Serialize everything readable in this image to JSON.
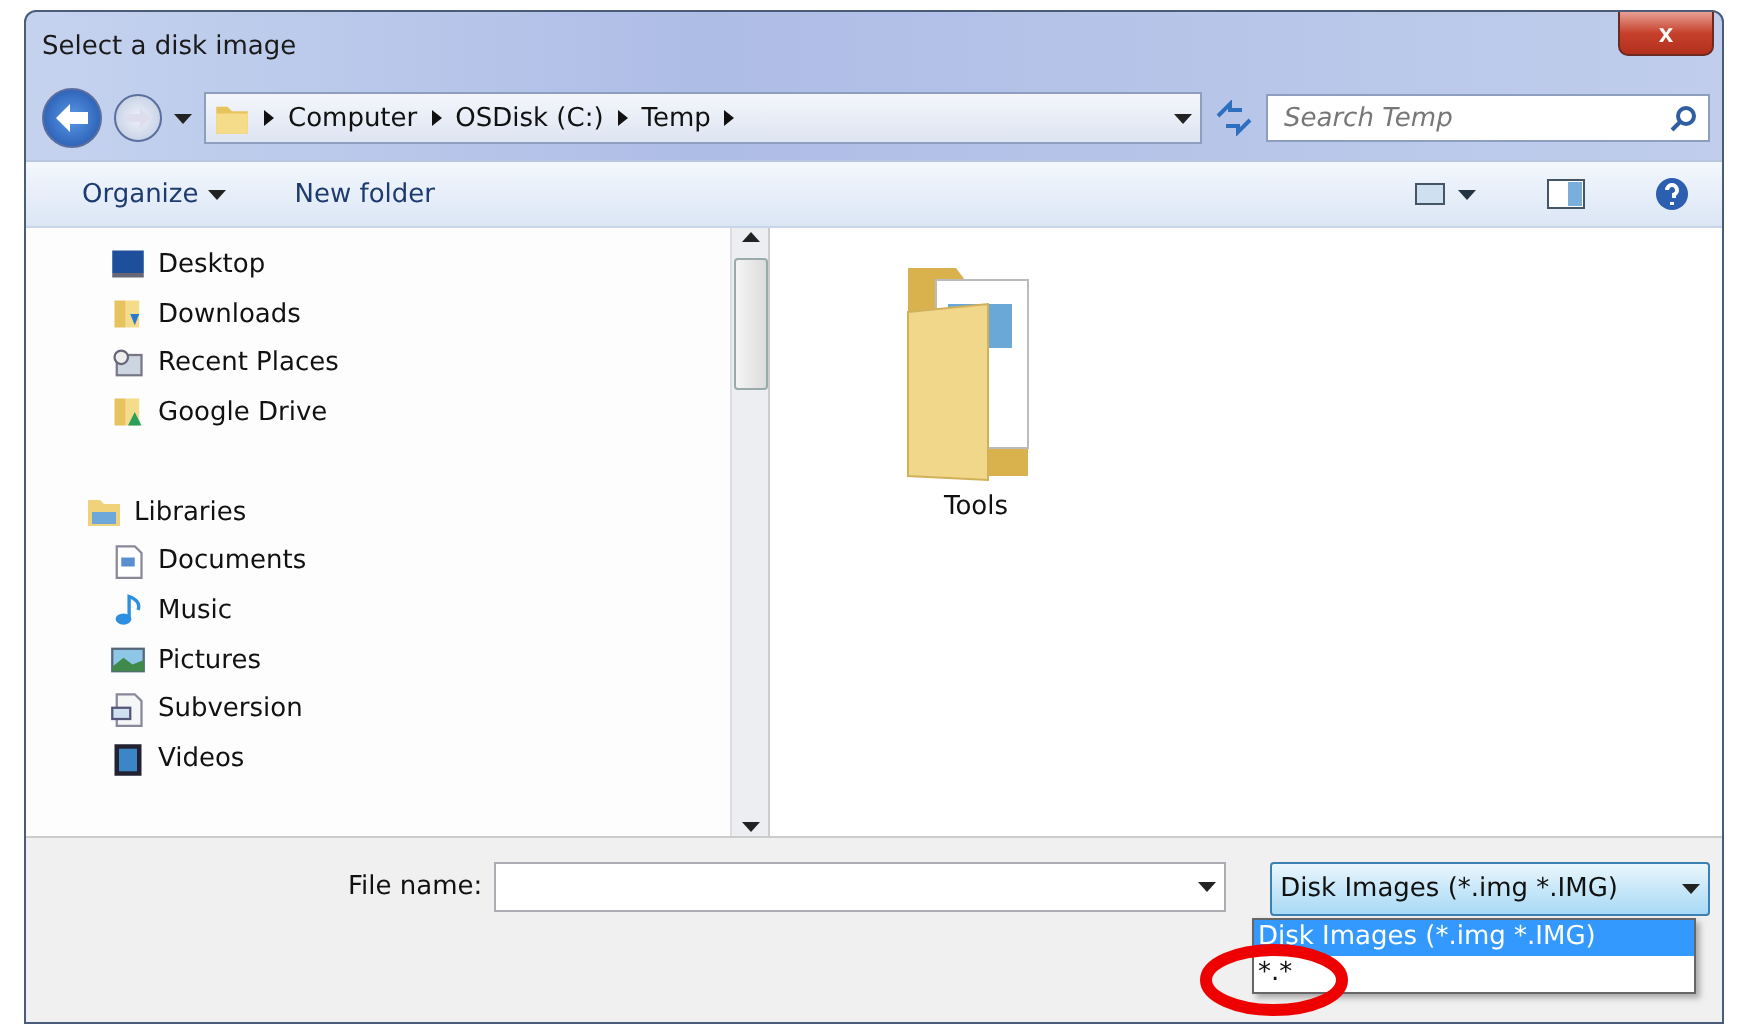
{
  "window": {
    "title": "Select a disk image",
    "close_label": "x"
  },
  "address_bar": {
    "crumbs": [
      "Computer",
      "OSDisk (C:)",
      "Temp"
    ]
  },
  "search": {
    "placeholder": "Search Temp"
  },
  "toolbar": {
    "organize": "Organize",
    "new_folder": "New folder"
  },
  "navigation": {
    "groups": [
      {
        "items": [
          {
            "label": "Desktop",
            "kind": "desktop"
          },
          {
            "label": "Downloads",
            "kind": "downloads"
          },
          {
            "label": "Recent Places",
            "kind": "recent"
          },
          {
            "label": "Google Drive",
            "kind": "drive"
          }
        ]
      },
      {
        "label": "Libraries",
        "items": [
          {
            "label": "Documents",
            "kind": "documents"
          },
          {
            "label": "Music",
            "kind": "music"
          },
          {
            "label": "Pictures",
            "kind": "pictures"
          },
          {
            "label": "Subversion",
            "kind": "subversion"
          },
          {
            "label": "Videos",
            "kind": "videos"
          }
        ]
      }
    ]
  },
  "files": [
    {
      "name": "Tools",
      "kind": "folder"
    }
  ],
  "file_name": {
    "label": "File name:"
  },
  "file_type": {
    "value": "Disk Images (*.img *.IMG)",
    "expanded": true,
    "options": [
      {
        "label": "Disk Images (*.img *.IMG)",
        "selected": true
      },
      {
        "label": "*.*",
        "selected": false
      }
    ]
  }
}
